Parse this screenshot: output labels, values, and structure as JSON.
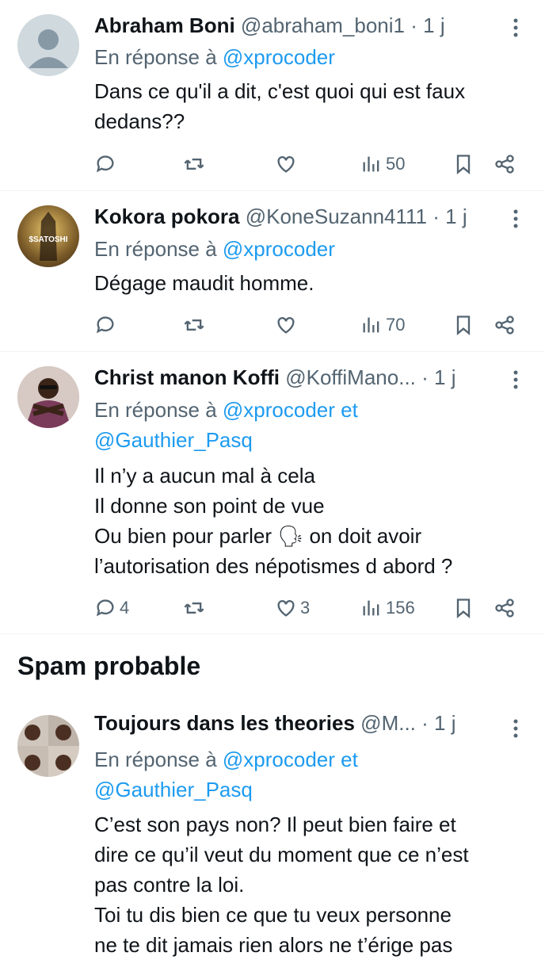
{
  "tweets": [
    {
      "name": "Abraham Boni",
      "handle": "@abraham_boni1",
      "time": "· 1 j",
      "reply_prefix": "En réponse à ",
      "reply_mentions": "@xprocoder",
      "reply_mentions_2": "",
      "text": "Dans ce qu'il a dit, c'est quoi qui est faux dedans??",
      "replies": "",
      "likes": "",
      "views": "50"
    },
    {
      "name": "Kokora pokora",
      "handle": "@KoneSuzann4111",
      "time": "· 1 j",
      "avatar_text": "$SATOSHI",
      "reply_prefix": "En réponse à ",
      "reply_mentions": "@xprocoder",
      "reply_mentions_2": "",
      "text": "Dégage maudit homme.",
      "replies": "",
      "likes": "",
      "views": "70"
    },
    {
      "name": "Christ manon Koffi",
      "handle": "@KoffiMano...",
      "time": "· 1 j",
      "reply_prefix": "En réponse à ",
      "reply_mentions": "@xprocoder et",
      "reply_mentions_2": "@Gauthier_Pasq",
      "text": "Il n’y a aucun mal à cela\nIl donne son point de vue\nOu bien pour parler 🗣 on doit avoir\nl’autorisation des népotismes d abord ?",
      "replies": "4",
      "likes": "3",
      "views": "156"
    }
  ],
  "spam_section": {
    "title": "Spam probable",
    "tweet": {
      "name": "Toujours dans les theories",
      "handle": "@M...",
      "time": "· 1 j",
      "reply_prefix": "En réponse à ",
      "reply_mentions": "@xprocoder et",
      "reply_mentions_2": "@Gauthier_Pasq",
      "text": "C’est son pays non? Il peut bien faire et\ndire ce qu’il veut du moment que ce n’est\npas contre la loi.\nToi tu dis bien ce que tu veux personne\nne te dit jamais rien alors ne t’érige pas"
    }
  },
  "colors": {
    "link": "#1d9bf0",
    "muted": "#536471",
    "text": "#0f1419",
    "divider": "#eff3f4"
  },
  "icons": [
    "reply-icon",
    "retweet-icon",
    "like-icon",
    "views-icon",
    "bookmark-icon",
    "share-icon",
    "more-icon"
  ]
}
